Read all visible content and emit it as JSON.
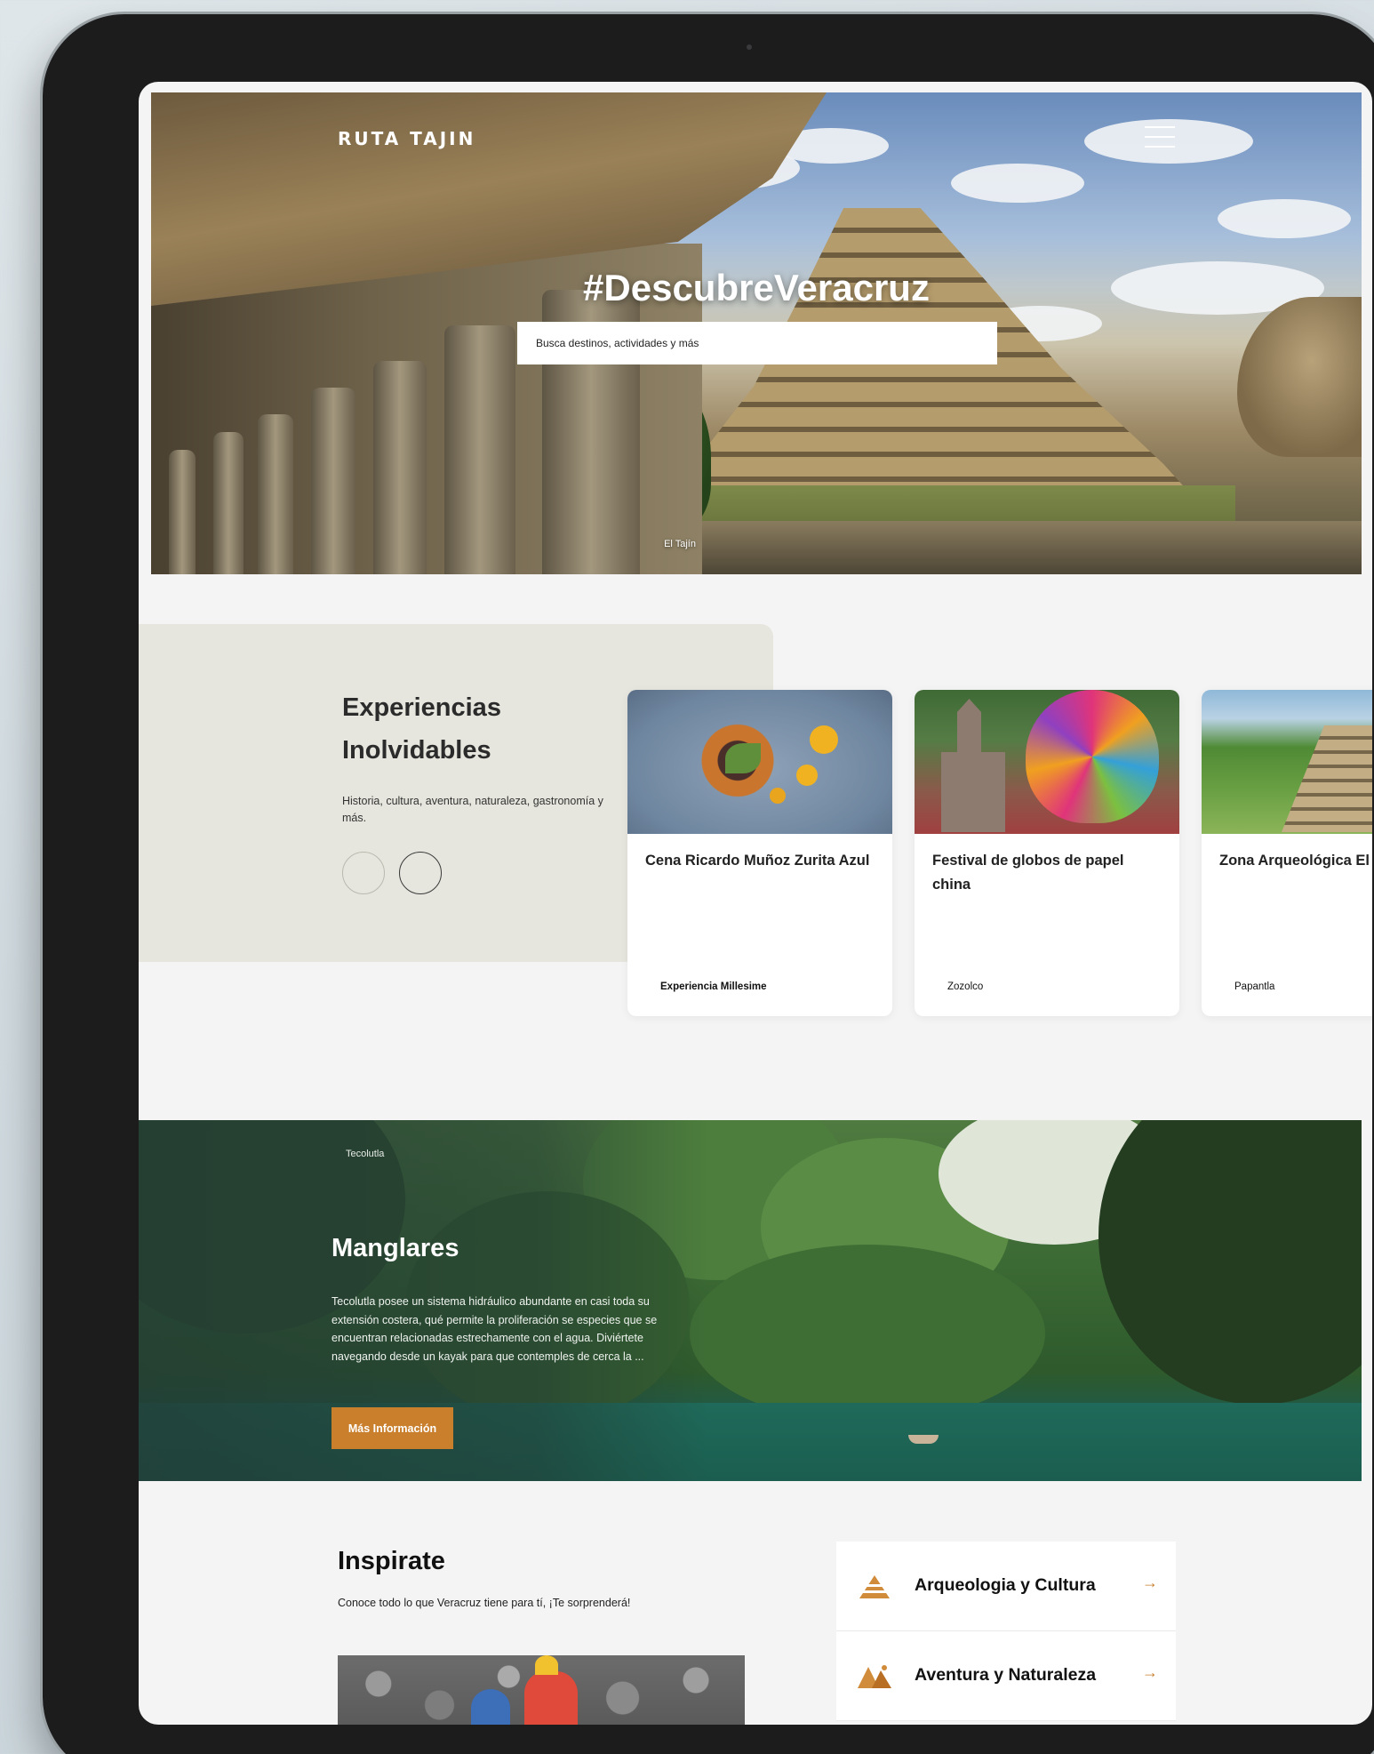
{
  "header": {
    "logo": "RUTA TAJIN",
    "menu_icon": "hamburger-icon"
  },
  "hero": {
    "title": "#DescubreVeracruz",
    "search_placeholder": "Busca destinos, actividades y más",
    "photo_caption": "El Tajín"
  },
  "experiences": {
    "title": "Experiencias Inolvidables",
    "description": "Historia, cultura, aventura, naturaleza, gastronomía y más.",
    "cards": [
      {
        "title": "Cena Ricardo Muñoz Zurita Azul",
        "tag": "Experiencia Millesime"
      },
      {
        "title": "Festival de globos de papel china",
        "tag": "Zozolco"
      },
      {
        "title": "Zona Arqueológica El Tajín",
        "tag": "Papantla"
      }
    ]
  },
  "feature": {
    "location": "Tecolutla",
    "title": "Manglares",
    "text": "Tecolutla posee un sistema hidráulico abundante en casi toda su extensión costera, qué permite la proliferación se especies que se encuentran relacionadas estrechamente con el agua. Diviértete navegando desde un kayak para que contemples de cerca la ...",
    "button": "Más Información"
  },
  "inspire": {
    "title": "Inspirate",
    "subtitle": "Conoce todo lo que Veracruz tiene para tí, ¡Te sorprenderá!",
    "categories": [
      {
        "label": "Arqueologia y Cultura",
        "icon": "pyramid-icon"
      },
      {
        "label": "Aventura y Naturaleza",
        "icon": "mountain-icon"
      }
    ]
  },
  "colors": {
    "accent": "#c97f2c",
    "panel": "#e6e6de",
    "device": "#1c1c1d"
  }
}
